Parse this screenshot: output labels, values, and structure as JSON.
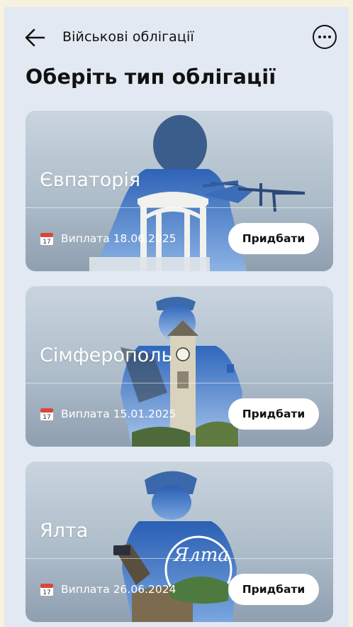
{
  "header": {
    "title": "Військові облігації",
    "back_icon": "arrow-left-icon",
    "more_icon": "more-horizontal-icon"
  },
  "page_title": "Оберіть тип облігації",
  "calendar_icon": "calendar-17-icon",
  "cards": [
    {
      "city": "Євпаторія",
      "payout": "Виплата 18.06.2025",
      "button": "Придбати"
    },
    {
      "city": "Сімферополь",
      "payout": "Виплата 15.01.2025",
      "button": "Придбати"
    },
    {
      "city": "Ялта",
      "payout": "Виплата 26.06.2024",
      "button": "Придбати",
      "logo_text": "Ялта"
    }
  ],
  "colors": {
    "background": "#e2e9f3",
    "card_gradient_top": "#c9d4de",
    "card_gradient_bottom": "#8f9fb0",
    "button_bg": "#ffffff",
    "text_dark": "#111111"
  }
}
